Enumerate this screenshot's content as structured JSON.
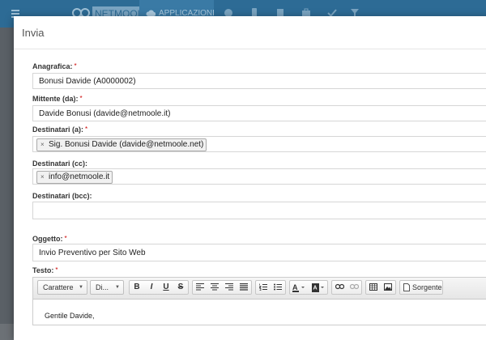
{
  "background": {
    "brand": "NETMOOLE",
    "apps_tab": "APPLICAZIONI"
  },
  "modal": {
    "title": "Invia"
  },
  "fields": {
    "anagrafica": {
      "label": "Anagrafica:",
      "required": "*",
      "value": "Bonusi Davide (A0000002)"
    },
    "mittente": {
      "label": "Mittente (da):",
      "required": "*",
      "value": "Davide Bonusi (davide@netmoole.it)"
    },
    "destinatari_a": {
      "label": "Destinatari (a):",
      "required": "*",
      "tag": "Sig. Bonusi Davide (davide@netmoole.net)",
      "tag_remove": "×"
    },
    "destinatari_cc": {
      "label": "Destinatari (cc):",
      "tag": "info@netmoole.it",
      "tag_remove": "×"
    },
    "destinatari_bcc": {
      "label": "Destinatari (bcc):",
      "value": ""
    },
    "oggetto": {
      "label": "Oggetto:",
      "required": "*",
      "value": "Invio Preventivo per Sito Web"
    },
    "testo": {
      "label": "Testo:",
      "required": "*"
    }
  },
  "editor": {
    "font_combo": "Carattere",
    "size_combo": "Di...",
    "bold": "B",
    "italic": "I",
    "underline": "U",
    "strike": "S",
    "source_label": "Sorgente",
    "content_first_line": "Gentile Davide,"
  },
  "colors": {
    "topbar": "#2d6b95",
    "required": "#cc0000"
  }
}
